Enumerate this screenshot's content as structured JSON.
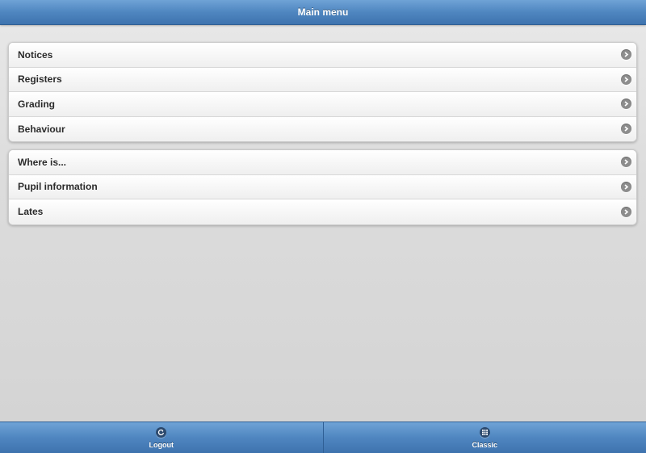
{
  "header": {
    "title": "Main menu"
  },
  "menu_group_1": [
    {
      "label": "Notices"
    },
    {
      "label": "Registers"
    },
    {
      "label": "Grading"
    },
    {
      "label": "Behaviour"
    }
  ],
  "menu_group_2": [
    {
      "label": "Where is..."
    },
    {
      "label": "Pupil information"
    },
    {
      "label": "Lates"
    }
  ],
  "footer": {
    "logout": {
      "label": "Logout",
      "icon": "refresh-icon"
    },
    "classic": {
      "label": "Classic",
      "icon": "grid-icon"
    }
  },
  "colors": {
    "header_blue": "#4f86c0",
    "background": "#d3d3d3",
    "arrow_gray": "#8d8d8d"
  }
}
